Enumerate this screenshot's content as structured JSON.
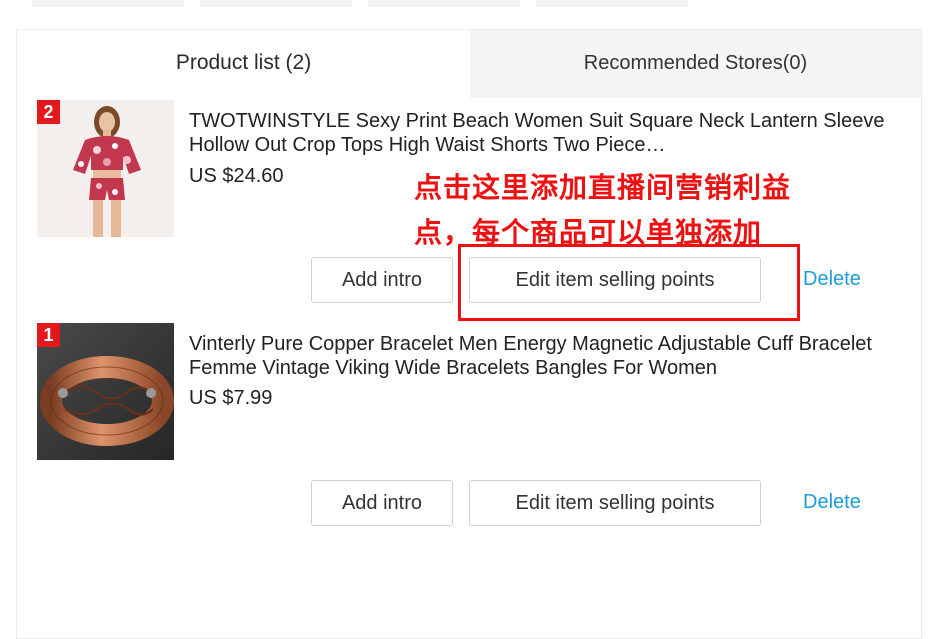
{
  "tabs": {
    "product_list": "Product list (2)",
    "recommended_stores": "Recommended Stores(0)"
  },
  "annotation": {
    "line1": "点击这里添加直播间营销利益",
    "line2": "点，每个商品可以单独添加"
  },
  "products": [
    {
      "rank": "2",
      "title": "TWOTWINSTYLE Sexy Print Beach Women Suit Square Neck Lantern Sleeve Hollow Out Crop Tops High Waist Shorts Two Piece…",
      "price": "US $24.60",
      "add_intro_label": "Add intro",
      "edit_points_label": "Edit item selling points",
      "delete_label": "Delete"
    },
    {
      "rank": "1",
      "title": "Vinterly Pure Copper Bracelet Men Energy Magnetic Adjustable Cuff Bracelet Femme Vintage Viking Wide Bracelets Bangles For Women",
      "price": "US $7.99",
      "add_intro_label": "Add intro",
      "edit_points_label": "Edit item selling points",
      "delete_label": "Delete"
    }
  ],
  "colors": {
    "accent_red": "#e4181b",
    "annotation_red": "#ee1111",
    "link_blue": "#1e9bd7"
  }
}
